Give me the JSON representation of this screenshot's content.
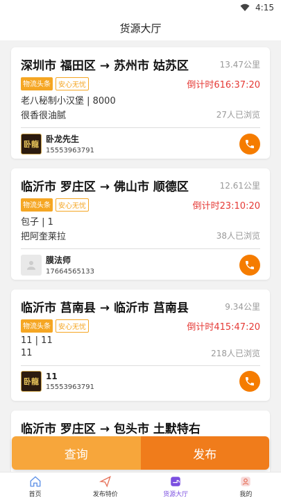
{
  "status": {
    "time": "4:15"
  },
  "header": {
    "title": "货源大厅"
  },
  "cards": [
    {
      "route": "深圳市 福田区 → 苏州市 姑苏区",
      "distance": "13.47公里",
      "tag1": "物流头条",
      "tag2": "安心无忧",
      "countdown": "倒计时616:37:20",
      "goods": "老八秘制小汉堡 | 8000",
      "desc": "很香很油腻",
      "views": "27人已浏览",
      "avatar_type": "logo",
      "avatar_text": "卧龍",
      "name": "卧龙先生",
      "phone": "15553963791"
    },
    {
      "route": "临沂市 罗庄区 → 佛山市 顺德区",
      "distance": "12.61公里",
      "tag1": "物流头条",
      "tag2": "安心无忧",
      "countdown": "倒计时23:10:20",
      "goods": "包子 | 1",
      "desc": "把阿奎莱拉",
      "views": "38人已浏览",
      "avatar_type": "blank",
      "avatar_text": "",
      "name": "膜法师",
      "phone": "17664565133"
    },
    {
      "route": "临沂市 莒南县 → 临沂市 莒南县",
      "distance": "9.34公里",
      "tag1": "物流头条",
      "tag2": "安心无忧",
      "countdown": "倒计时415:47:20",
      "goods": "11 | 11",
      "desc": "11",
      "views": "218人已浏览",
      "avatar_type": "logo",
      "avatar_text": "卧龍",
      "name": "11",
      "phone": "15553963791"
    },
    {
      "route": "临沂市 罗庄区 → 包头市 土默特右",
      "distance": "",
      "tag1": "",
      "tag2": "",
      "countdown": "",
      "goods": "",
      "desc": "",
      "views": "",
      "avatar_type": "blank",
      "avatar_text": "",
      "name": "",
      "phone": ""
    }
  ],
  "actions": {
    "query": "查询",
    "publish": "发布"
  },
  "tabs": [
    {
      "label": "首页",
      "icon": "home-icon"
    },
    {
      "label": "发布特价",
      "icon": "send-icon"
    },
    {
      "label": "货源大厅",
      "icon": "cargo-hall-icon",
      "active": true
    },
    {
      "label": "我的",
      "icon": "user-icon"
    }
  ],
  "colors": {
    "accent": "#f57c00",
    "countdown": "#e53935",
    "tab_active": "#7b4fe0"
  }
}
